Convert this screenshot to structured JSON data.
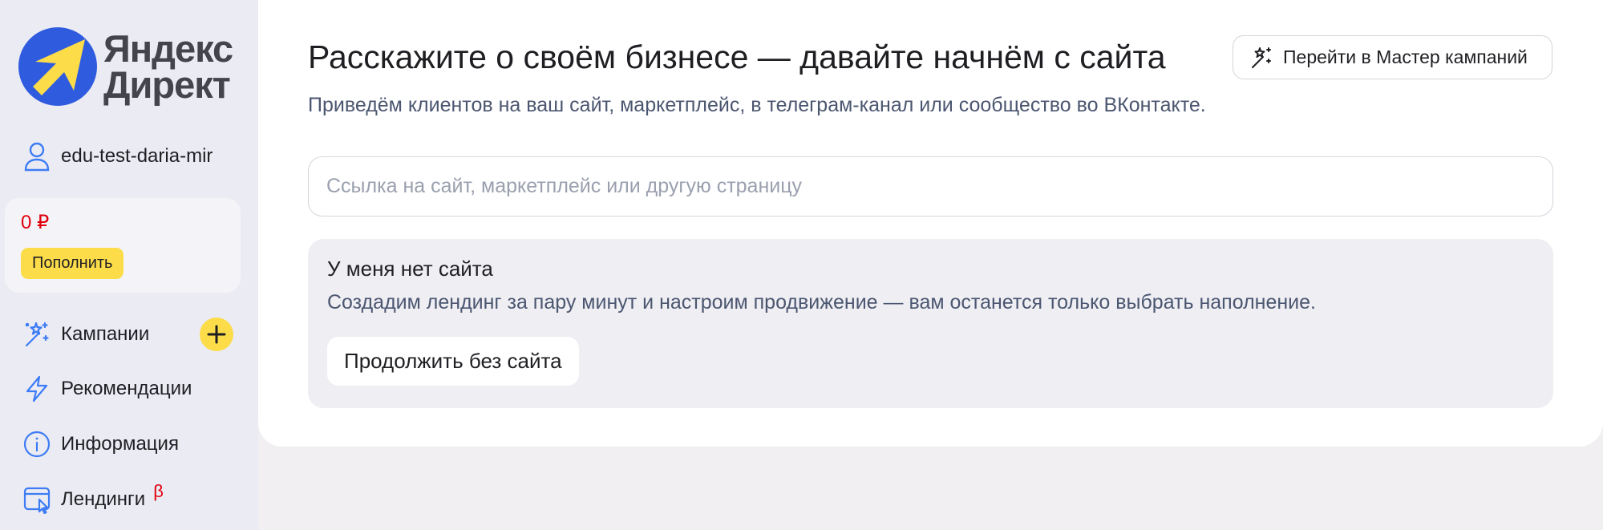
{
  "brand": {
    "line1": "Яндекс",
    "line2": "Директ",
    "logo_colors": {
      "circle": "#2f5bdf",
      "arrow": "#fddc4a"
    }
  },
  "user": {
    "login": "edu-test-daria-mir",
    "icon": "user-icon"
  },
  "balance": {
    "amount": "0 ₽",
    "topup_label": "Пополнить"
  },
  "nav": {
    "items": [
      {
        "label": "Кампании",
        "icon": "magic-wand-icon"
      },
      {
        "label": "Рекомендации",
        "icon": "lightning-icon"
      },
      {
        "label": "Информация",
        "icon": "info-icon"
      },
      {
        "label": "Лендинги",
        "icon": "landing-page-icon",
        "badge": "β"
      }
    ],
    "add_campaign_icon": "plus-icon"
  },
  "main": {
    "title": "Расскажите о своём бизнесе — давайте начнём с сайта",
    "subtitle": "Приведём клиентов на ваш сайт, маркетплейс, в телеграм-канал или сообщество во ВКонтакте.",
    "master_button_label": "Перейти в Мастер кампаний",
    "url_input": {
      "value": "",
      "placeholder": "Ссылка на сайт, маркетплейс или другую страницу"
    },
    "no_site": {
      "title": "У меня нет сайта",
      "description": "Создадим лендинг за пару минут и настроим продвижение — вам останется только выбрать наполнение.",
      "button_label": "Продолжить без сайта"
    }
  },
  "colors": {
    "accent_yellow": "#fddc4a",
    "icon_blue": "#3d7cf5",
    "alert_red": "#e0000d",
    "secondary_text": "#4b5670"
  }
}
